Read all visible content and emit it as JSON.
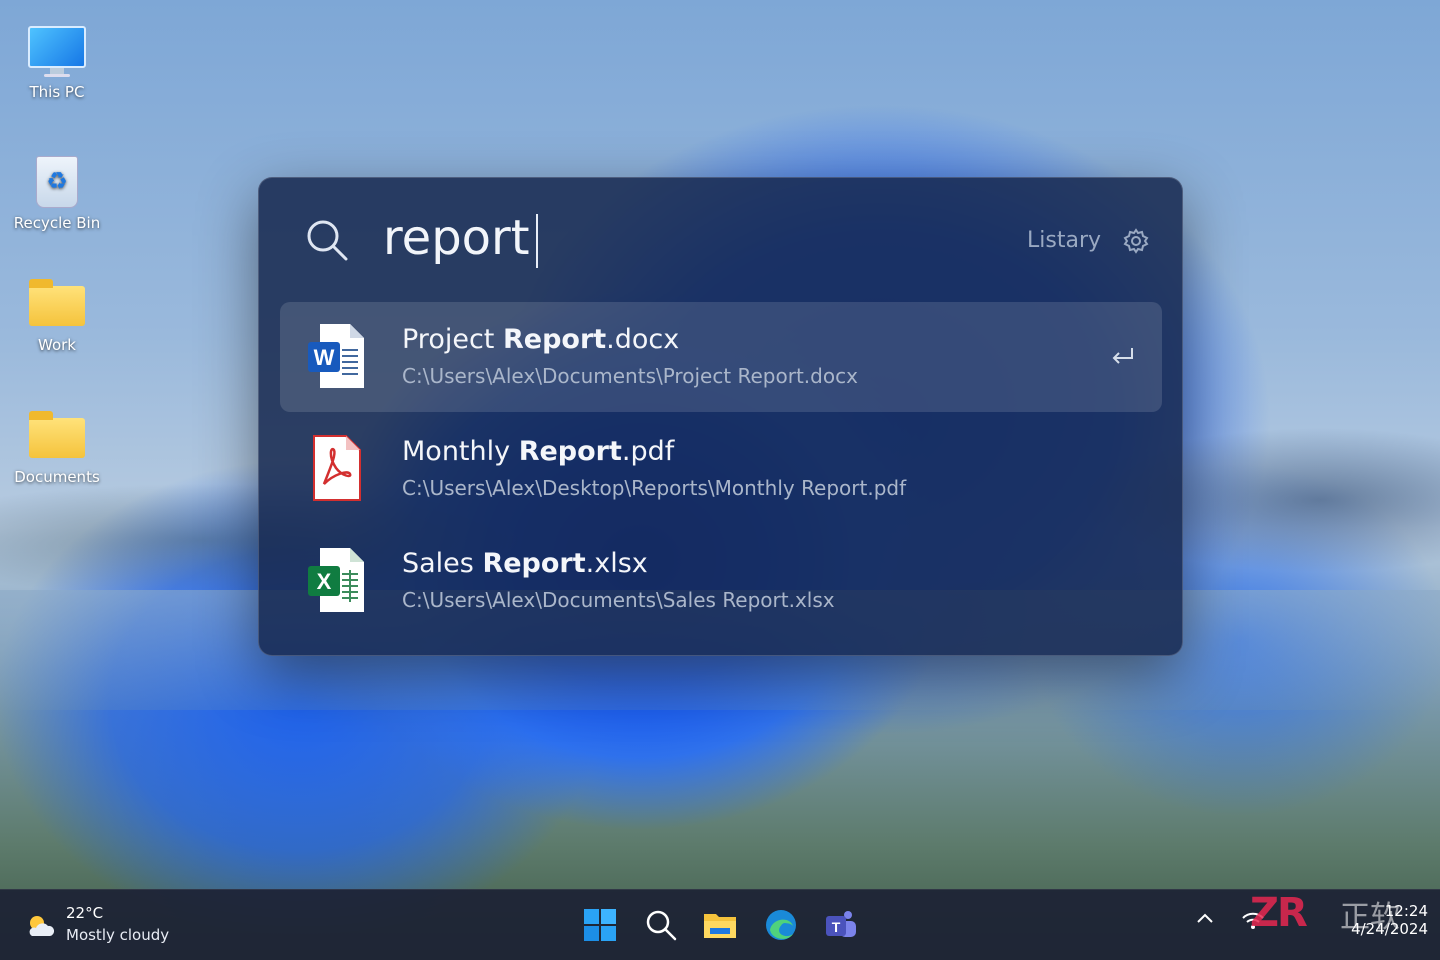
{
  "desktop": {
    "icons": [
      {
        "label": "This PC",
        "icon": "monitor-icon"
      },
      {
        "label": "Recycle Bin",
        "icon": "recycle-bin-icon"
      },
      {
        "label": "Work",
        "icon": "folder-icon"
      },
      {
        "label": "Documents",
        "icon": "folder-icon"
      }
    ]
  },
  "launcher": {
    "query": "report",
    "brand": "Listary",
    "results": [
      {
        "prefix": "Project ",
        "match": "Report",
        "suffix": ".docx",
        "path": "C:\\Users\\Alex\\Documents\\Project Report.docx",
        "icon": "word-icon",
        "selected": true
      },
      {
        "prefix": "Monthly ",
        "match": "Report",
        "suffix": ".pdf",
        "path": "C:\\Users\\Alex\\Desktop\\Reports\\Monthly Report.pdf",
        "icon": "pdf-icon",
        "selected": false
      },
      {
        "prefix": "Sales ",
        "match": "Report",
        "suffix": ".xlsx",
        "path": "C:\\Users\\Alex\\Documents\\Sales Report.xlsx",
        "icon": "excel-icon",
        "selected": false
      }
    ]
  },
  "taskbar": {
    "weather": {
      "temp": "22°C",
      "desc": "Mostly cloudy"
    },
    "apps": [
      "start-icon",
      "search-icon",
      "file-explorer-icon",
      "edge-icon",
      "teams-icon"
    ],
    "clock": {
      "time": "12:24",
      "date": "4/24/2024"
    }
  },
  "colors": {
    "panel": "#16284e",
    "word": "#185abd",
    "pdf": "#d32f2f",
    "excel": "#107c41"
  },
  "watermark": {
    "logo": "ZR",
    "text": "正软"
  }
}
